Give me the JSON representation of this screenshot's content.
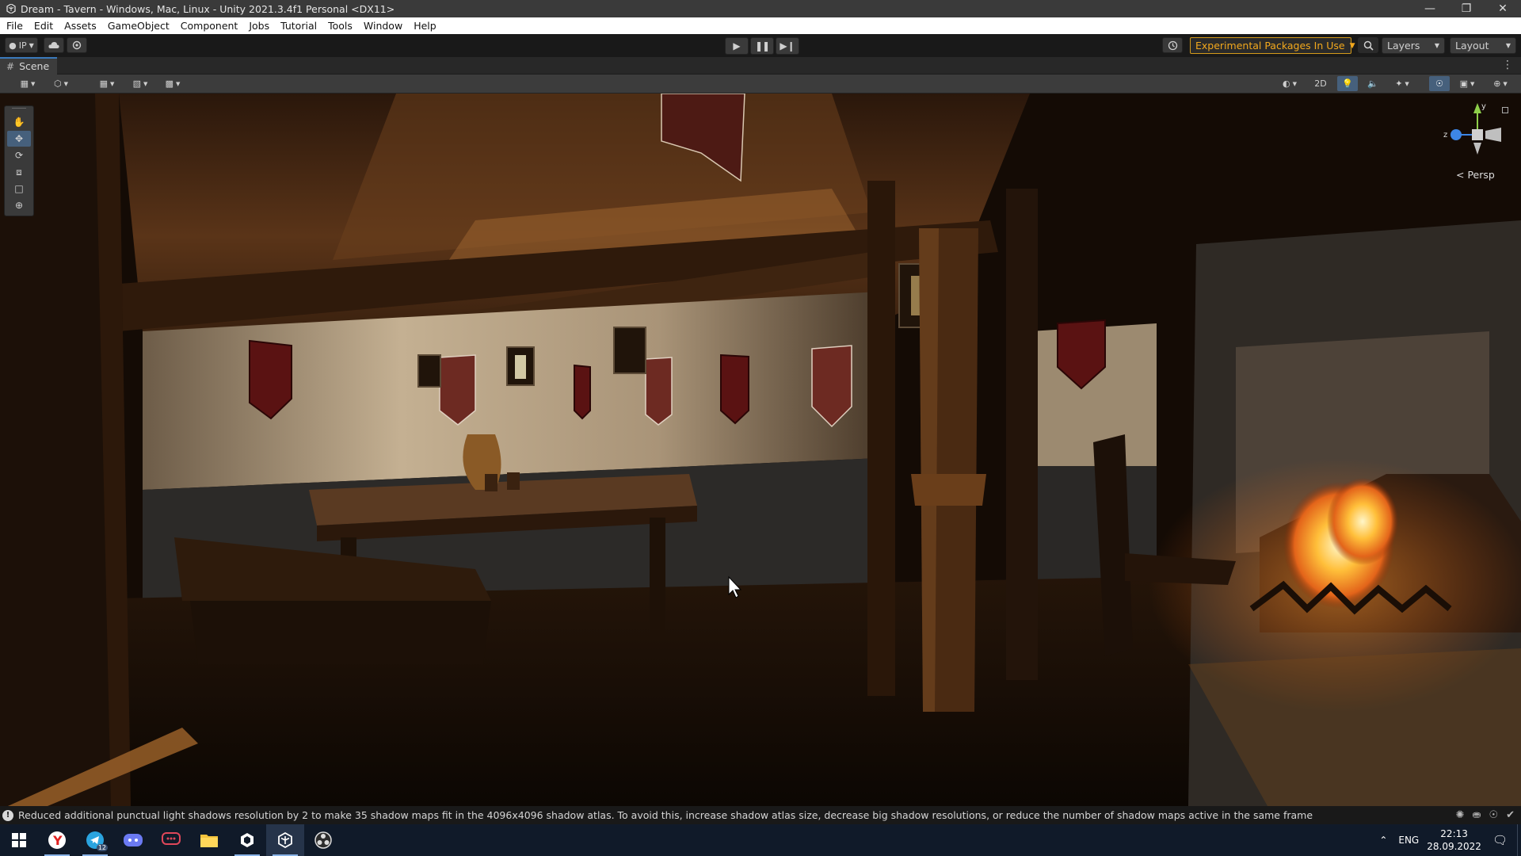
{
  "window": {
    "title": "Dream - Tavern - Windows, Mac, Linux - Unity 2021.3.4f1 Personal <DX11>",
    "app_icon": "unity-icon",
    "controls": [
      "minimize-icon",
      "restore-icon",
      "close-icon"
    ]
  },
  "menu": [
    "File",
    "Edit",
    "Assets",
    "GameObject",
    "Component",
    "Jobs",
    "Tutorial",
    "Tools",
    "Window",
    "Help"
  ],
  "toolbar": {
    "account_label": "IP",
    "experimental_packages_label": "Experimental Packages In Use",
    "layers_label": "Layers",
    "layout_label": "Layout",
    "accent_color": "#f2a81d"
  },
  "scene_tab": {
    "label": "Scene"
  },
  "scene_toolbar": {
    "toggle_2d_label": "2D"
  },
  "gizmo": {
    "y_label": "y",
    "z_label": "z",
    "projection_label": "< Persp",
    "x_color": "#e04040",
    "y_color": "#8ecf4a",
    "z_color": "#3d86e6"
  },
  "tools": [
    "hand-tool-icon",
    "move-tool-icon",
    "rotate-tool-icon",
    "scale-tool-icon",
    "rect-tool-icon",
    "transform-tool-icon"
  ],
  "status_bar": {
    "message": "Reduced additional punctual light shadows resolution by 2 to make 35 shadow maps fit in the 4096x4096 shadow atlas. To avoid this, increase shadow atlas size, decrease big shadow resolutions, or reduce the number of shadow maps active in the same frame"
  },
  "taskbar": {
    "apps": [
      "windows-start-icon",
      "yandex-browser-icon",
      "telegram-icon",
      "discord-icon",
      "speech-app-icon",
      "file-explorer-icon",
      "unity-hub-icon",
      "unity-editor-icon",
      "obs-icon"
    ],
    "telegram_badge": "12",
    "language": "ENG",
    "time": "22:13",
    "date": "28.09.2022"
  }
}
